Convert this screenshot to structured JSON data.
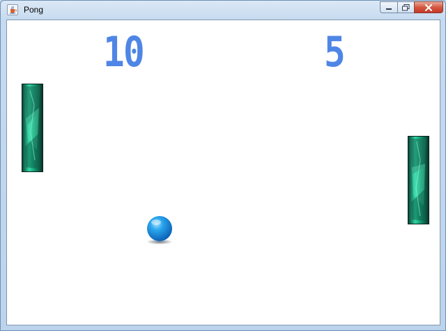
{
  "window": {
    "title": "Pong"
  },
  "titlebar": {
    "app_icon": "java-cup-icon",
    "minimize_icon": "minimize-icon",
    "maximize_icon": "maximize-icon",
    "close_icon": "close-icon"
  },
  "game": {
    "score_left": "10",
    "score_right": "5",
    "colors": {
      "score": "#4f86e6",
      "paddle": "#1fb184",
      "ball": "#1e8fe0",
      "background": "#ffffff"
    }
  }
}
